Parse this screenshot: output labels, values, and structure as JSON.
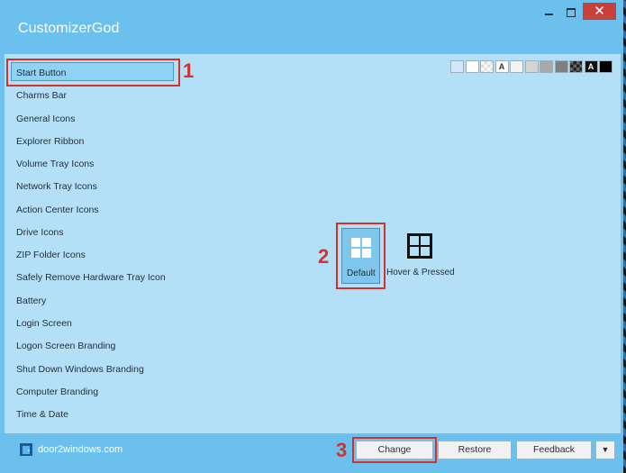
{
  "window": {
    "title": "CustomizerGod",
    "close_glyph": "✕"
  },
  "swatches": [
    {
      "color": "#d2e8f8"
    },
    {
      "color": "#ffffff"
    },
    {
      "color": "#f4f4f4",
      "pattern": "checker"
    },
    {
      "color": "#ffffff",
      "letter": "A"
    },
    {
      "color": "#f3f3f3"
    },
    {
      "color": "#d4d4d4"
    },
    {
      "color": "#a9a9a9"
    },
    {
      "color": "#808080"
    },
    {
      "color": "#3c3c3c",
      "pattern": "dark-checker"
    },
    {
      "color": "#111111",
      "letter": "A",
      "letter_color": "#ffffff"
    },
    {
      "color": "#000000"
    }
  ],
  "sidebar": {
    "items": [
      "Start Button",
      "Charms Bar",
      "General Icons",
      "Explorer Ribbon",
      "Volume Tray Icons",
      "Network Tray Icons",
      "Action Center Icons",
      "Drive Icons",
      "ZIP Folder Icons",
      "Safely Remove Hardware Tray Icon",
      "Battery",
      "Login Screen",
      "Logon Screen Branding",
      "Shut Down Windows Branding",
      "Computer Branding",
      "Time & Date"
    ]
  },
  "options": {
    "default_label": "Default",
    "hover_label": "Hover & Pressed"
  },
  "footer": {
    "site": "door2windows.com",
    "change": "Change",
    "restore": "Restore",
    "feedback": "Feedback",
    "dropdown_glyph": "▼"
  },
  "annotations": [
    "1",
    "2",
    "3"
  ],
  "colors": {
    "accent": "#6cc0ee",
    "content_bg": "#b3e0f7",
    "annotation": "#d5312b",
    "selected": "#8fd3f4"
  }
}
